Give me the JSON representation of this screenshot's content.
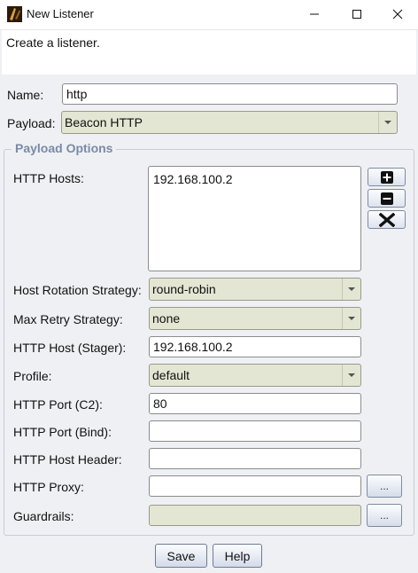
{
  "window": {
    "title": "New Listener",
    "controls": {
      "minimize": "minimize-icon",
      "maximize": "maximize-icon",
      "close": "close-icon"
    }
  },
  "banner": {
    "text": "Create a listener."
  },
  "form": {
    "name_label": "Name:",
    "name_value": "http",
    "payload_label": "Payload:",
    "payload_value": "Beacon HTTP"
  },
  "options": {
    "group_title": "Payload Options",
    "http_hosts_label": "HTTP Hosts:",
    "http_hosts": [
      "192.168.100.2"
    ],
    "host_rotation_label": "Host Rotation Strategy:",
    "host_rotation_value": "round-robin",
    "max_retry_label": "Max Retry Strategy:",
    "max_retry_value": "none",
    "stager_host_label": "HTTP Host (Stager):",
    "stager_host_value": "192.168.100.2",
    "profile_label": "Profile:",
    "profile_value": "default",
    "port_c2_label": "HTTP Port (C2):",
    "port_c2_value": "80",
    "port_bind_label": "HTTP Port (Bind):",
    "port_bind_value": "",
    "host_header_label": "HTTP Host Header:",
    "host_header_value": "",
    "proxy_label": "HTTP Proxy:",
    "proxy_value": "",
    "proxy_button": "...",
    "guardrails_label": "Guardrails:",
    "guardrails_value": "",
    "guardrails_button": "..."
  },
  "host_buttons": {
    "add": "plus-icon",
    "remove": "minus-icon",
    "clear": "x-icon"
  },
  "buttons": {
    "save": "Save",
    "help": "Help"
  },
  "colors": {
    "combo_bg": "#e3e6d2",
    "group_title": "#7a8aa8",
    "window_bg": "#eef0f4"
  }
}
